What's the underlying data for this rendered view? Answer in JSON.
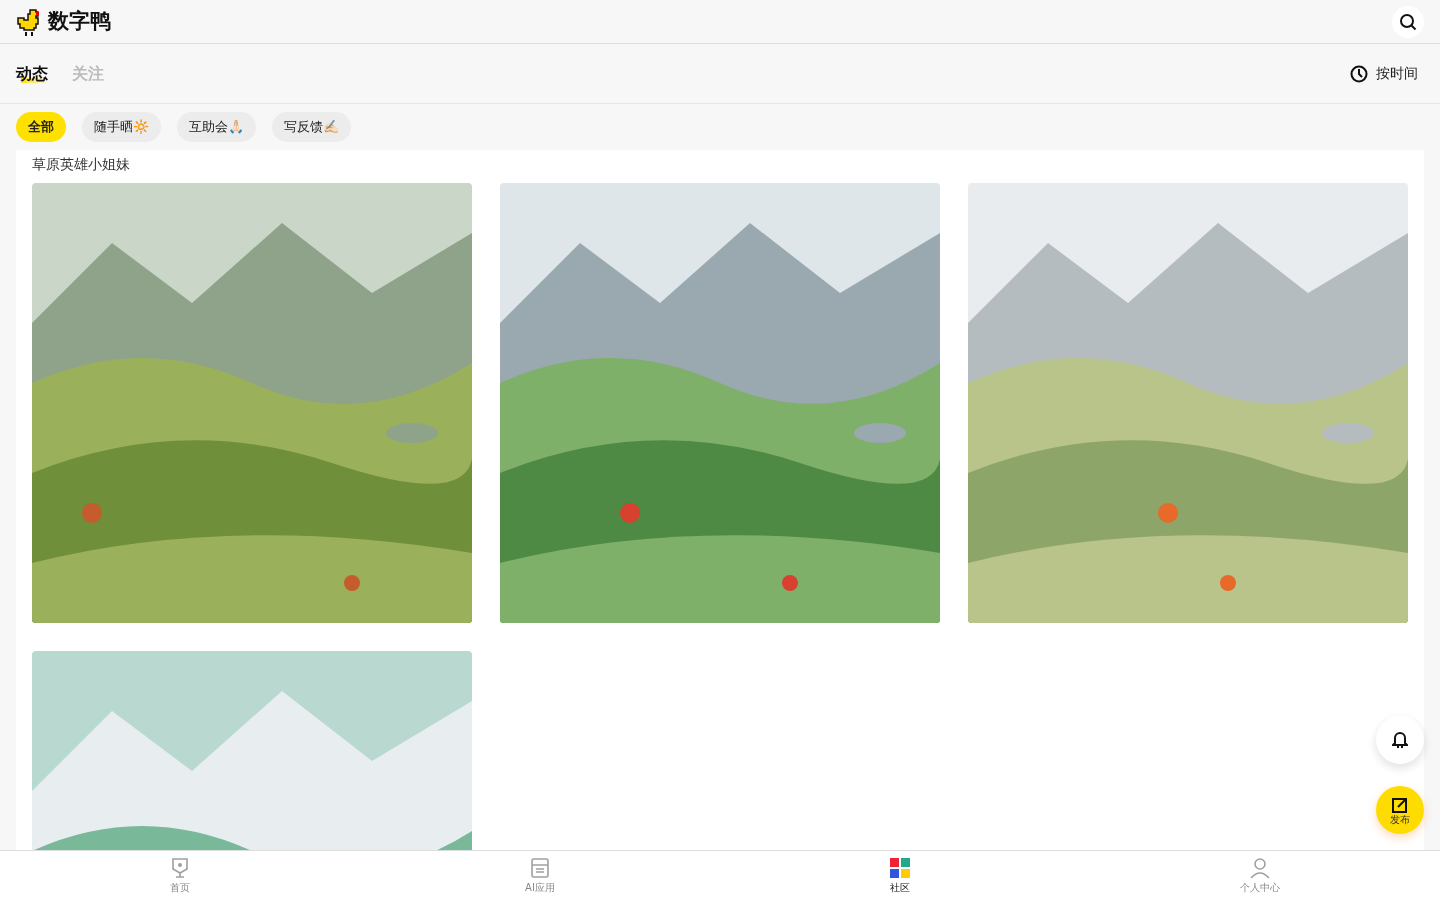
{
  "app": {
    "title": "数字鸭"
  },
  "tabs": [
    {
      "label": "动态",
      "selected": true
    },
    {
      "label": "关注",
      "selected": false
    }
  ],
  "sort": {
    "label": "按时间"
  },
  "chips": [
    {
      "label": "全部",
      "selected": true
    },
    {
      "label": "随手晒🔆",
      "selected": false
    },
    {
      "label": "互助会🙏🏻",
      "selected": false
    },
    {
      "label": "写反馈✍🏻",
      "selected": false
    }
  ],
  "post": {
    "title": "草原英雄小姐妹"
  },
  "fab": {
    "label": "发布"
  },
  "nav": [
    {
      "label": "首页",
      "selected": false,
      "kind": "home"
    },
    {
      "label": "AI应用",
      "selected": false,
      "kind": "apps"
    },
    {
      "label": "社区",
      "selected": true,
      "kind": "community"
    },
    {
      "label": "个人中心",
      "selected": false,
      "kind": "profile"
    }
  ]
}
